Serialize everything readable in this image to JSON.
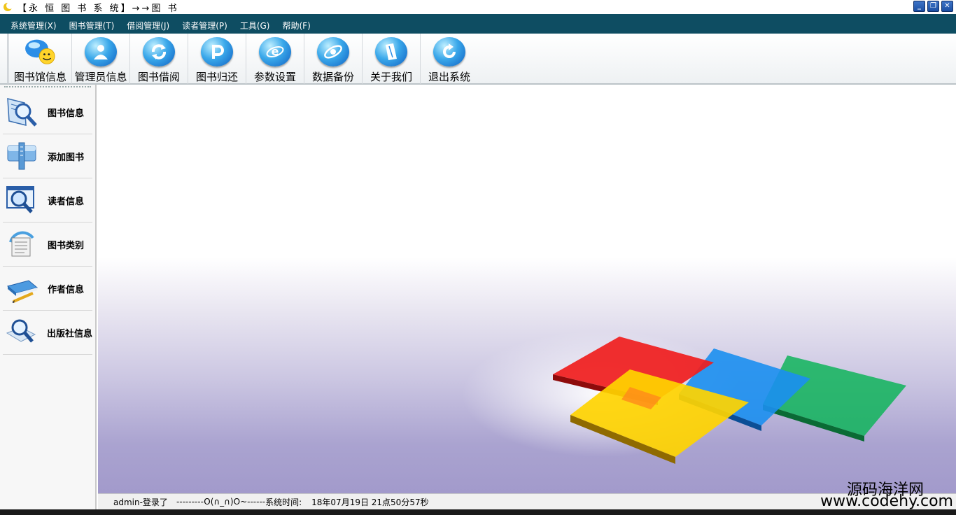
{
  "window": {
    "title": "【永 恒 图 书 系 统】→→图 书"
  },
  "menu": {
    "items": [
      {
        "label": "系统管理(X)"
      },
      {
        "label": "图书管理(T)"
      },
      {
        "label": "借阅管理(J)"
      },
      {
        "label": "读者管理(P)"
      },
      {
        "label": "工具(G)"
      },
      {
        "label": "帮助(F)"
      }
    ]
  },
  "toolbar": {
    "buttons": [
      {
        "label": "图书馆信息",
        "icon": "library-info-icon"
      },
      {
        "label": "管理员信息",
        "icon": "admin-info-icon"
      },
      {
        "label": "图书借阅",
        "icon": "book-borrow-icon"
      },
      {
        "label": "图书归还",
        "icon": "book-return-icon"
      },
      {
        "label": "参数设置",
        "icon": "settings-icon"
      },
      {
        "label": "数据备份",
        "icon": "backup-icon"
      },
      {
        "label": "关于我们",
        "icon": "about-icon"
      },
      {
        "label": "退出系统",
        "icon": "exit-icon"
      }
    ]
  },
  "sidebar": {
    "items": [
      {
        "label": "图书信息",
        "icon": "book-search-icon"
      },
      {
        "label": "添加图书",
        "icon": "add-book-icon"
      },
      {
        "label": "读者信息",
        "icon": "reader-search-icon"
      },
      {
        "label": "图书类别",
        "icon": "category-icon"
      },
      {
        "label": "作者信息",
        "icon": "author-icon"
      },
      {
        "label": "出版社信息",
        "icon": "publisher-icon"
      }
    ]
  },
  "status": {
    "user": "admin-登录了",
    "decoration": "---------O(∩_∩)O~------",
    "time_label": "系统时间:",
    "time_value": "18年07月19日 21点50分57秒"
  },
  "watermark": {
    "line1": "源码海洋网",
    "line2": "www.codehy.com"
  },
  "colors": {
    "menubar": "#0e4d62",
    "accent_blue": "#1b6fd6"
  }
}
